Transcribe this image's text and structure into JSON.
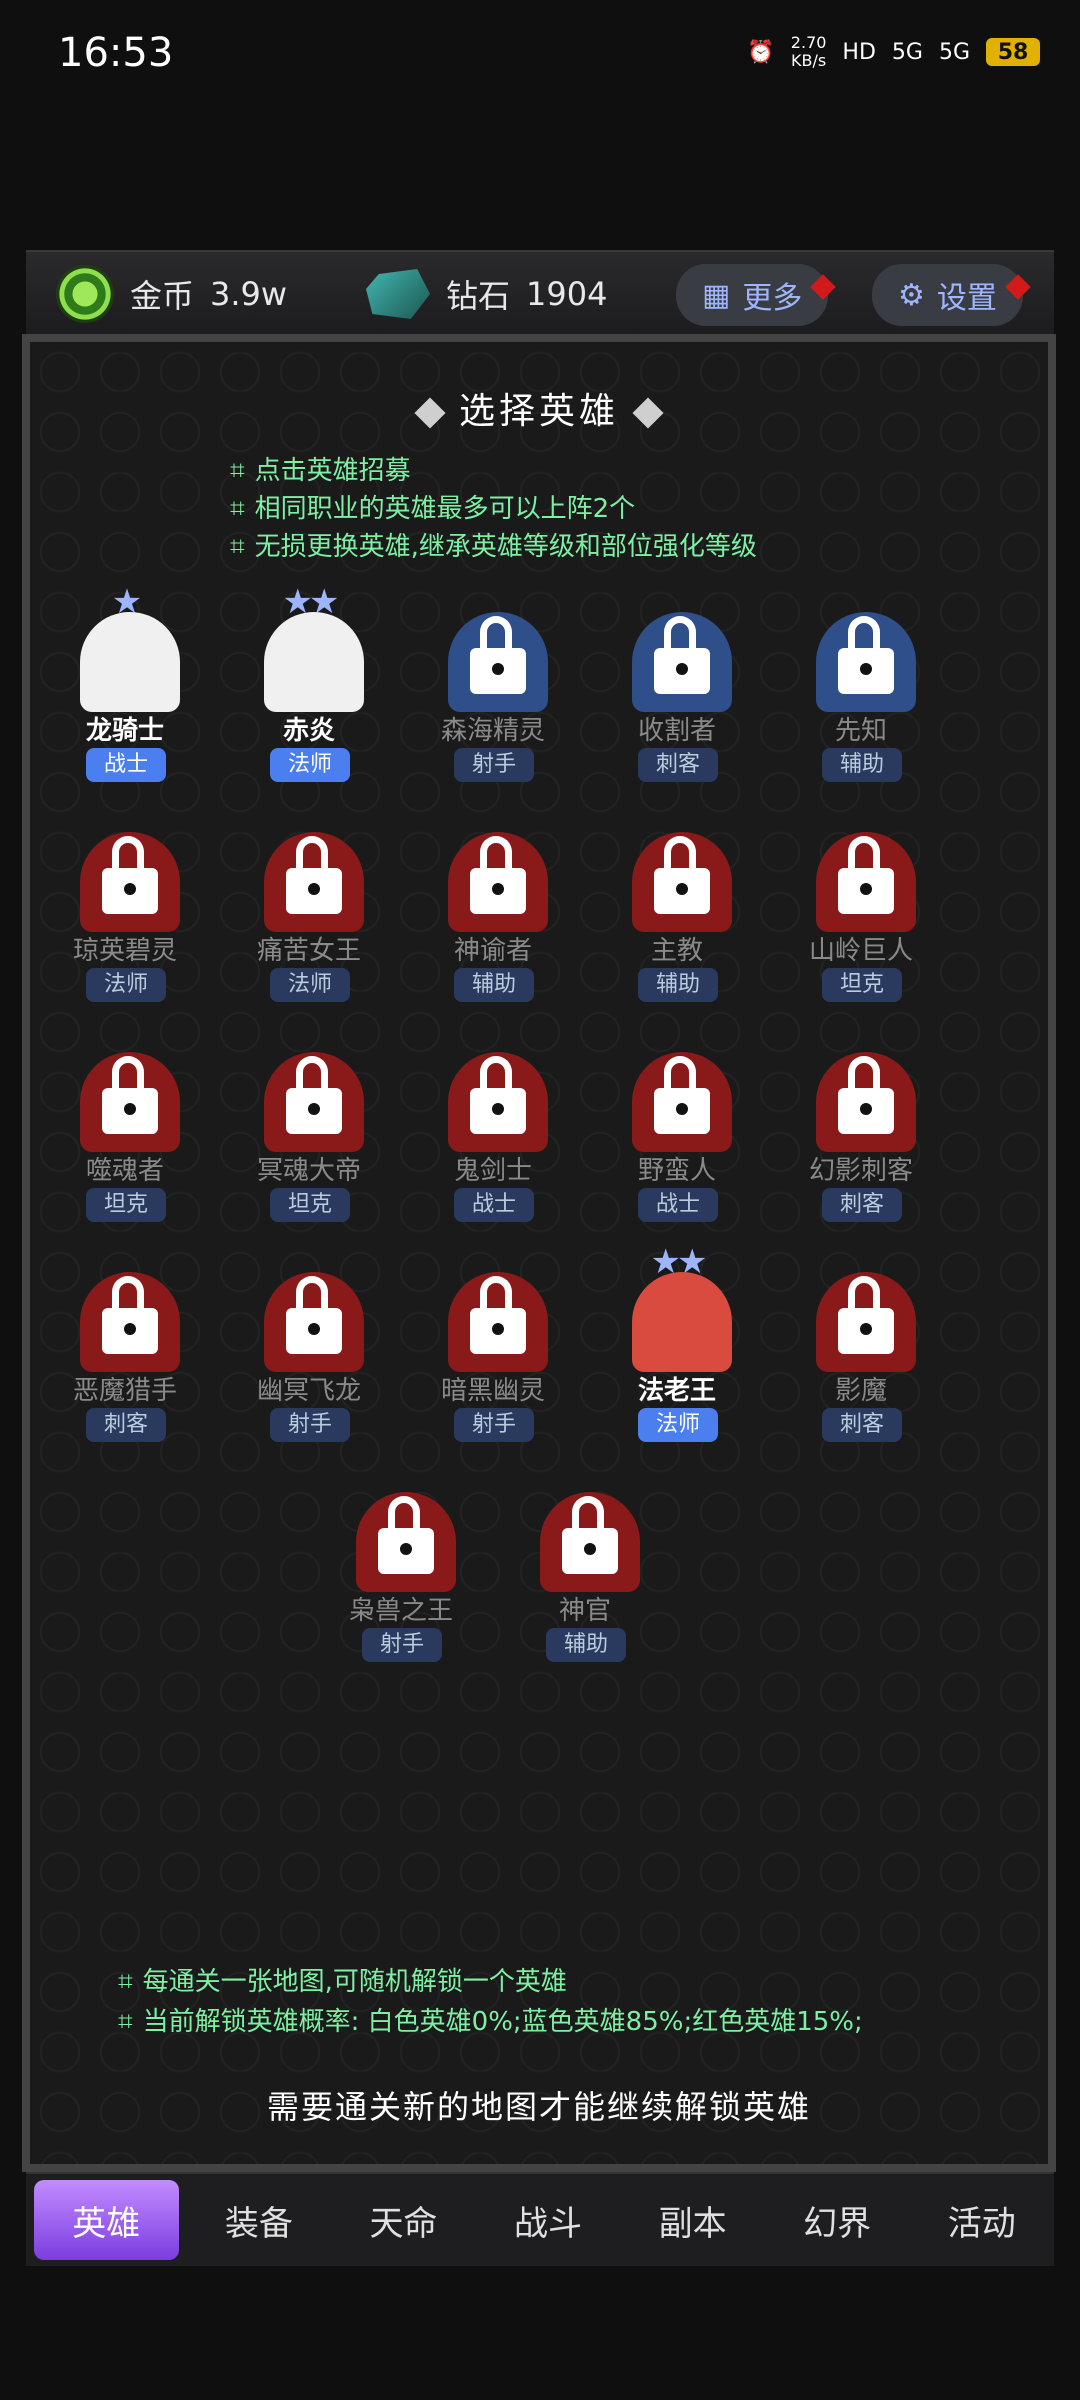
{
  "status": {
    "time": "16:53",
    "net_speed": "2.70",
    "net_unit": "KB/s",
    "hd": "HD",
    "sig1": "5G",
    "sig2": "5G",
    "battery": "58"
  },
  "resources": {
    "coin_label": "金币",
    "coin_value": "3.9w",
    "gem_label": "钻石",
    "gem_value": "1904"
  },
  "buttons": {
    "more": "更多",
    "settings": "设置"
  },
  "panel": {
    "title": "选择英雄",
    "tips": [
      "点击英雄招募",
      "相同职业的英雄最多可以上阵2个",
      "无损更换英雄,继承英雄等级和部位强化等级"
    ],
    "bottom_tips": [
      "每通关一张地图,可随机解锁一个英雄",
      "当前解锁英雄概率: 白色英雄0%;蓝色英雄85%;红色英雄15%;"
    ],
    "unlock_message": "需要通关新的地图才能继续解锁英雄"
  },
  "heroes": [
    {
      "name": "龙骑士",
      "class": "战士",
      "stars": "★",
      "color": "white",
      "unlocked": true
    },
    {
      "name": "赤炎",
      "class": "法师",
      "stars": "★★",
      "color": "white",
      "unlocked": true
    },
    {
      "name": "森海精灵",
      "class": "射手",
      "stars": "",
      "color": "blue",
      "unlocked": false
    },
    {
      "name": "收割者",
      "class": "刺客",
      "stars": "",
      "color": "blue",
      "unlocked": false
    },
    {
      "name": "先知",
      "class": "辅助",
      "stars": "",
      "color": "blue",
      "unlocked": false
    },
    {
      "name": "琼英碧灵",
      "class": "法师",
      "stars": "",
      "color": "red",
      "unlocked": false
    },
    {
      "name": "痛苦女王",
      "class": "法师",
      "stars": "",
      "color": "red",
      "unlocked": false
    },
    {
      "name": "神谕者",
      "class": "辅助",
      "stars": "",
      "color": "red",
      "unlocked": false
    },
    {
      "name": "主教",
      "class": "辅助",
      "stars": "",
      "color": "red",
      "unlocked": false
    },
    {
      "name": "山岭巨人",
      "class": "坦克",
      "stars": "",
      "color": "red",
      "unlocked": false
    },
    {
      "name": "噬魂者",
      "class": "坦克",
      "stars": "",
      "color": "red",
      "unlocked": false
    },
    {
      "name": "冥魂大帝",
      "class": "坦克",
      "stars": "",
      "color": "red",
      "unlocked": false
    },
    {
      "name": "鬼剑士",
      "class": "战士",
      "stars": "",
      "color": "red",
      "unlocked": false
    },
    {
      "name": "野蛮人",
      "class": "战士",
      "stars": "",
      "color": "red",
      "unlocked": false
    },
    {
      "name": "幻影刺客",
      "class": "刺客",
      "stars": "",
      "color": "red",
      "unlocked": false
    },
    {
      "name": "恶魔猎手",
      "class": "刺客",
      "stars": "",
      "color": "red",
      "unlocked": false
    },
    {
      "name": "幽冥飞龙",
      "class": "射手",
      "stars": "",
      "color": "red",
      "unlocked": false
    },
    {
      "name": "暗黑幽灵",
      "class": "射手",
      "stars": "",
      "color": "red",
      "unlocked": false
    },
    {
      "name": "法老王",
      "class": "法师",
      "stars": "★★",
      "color": "redlit",
      "unlocked": true
    },
    {
      "name": "影魔",
      "class": "刺客",
      "stars": "",
      "color": "red",
      "unlocked": false
    },
    {
      "name": "枭兽之王",
      "class": "射手",
      "stars": "",
      "color": "red",
      "unlocked": false
    },
    {
      "name": "神官",
      "class": "辅助",
      "stars": "",
      "color": "red",
      "unlocked": false
    }
  ],
  "nav": [
    "英雄",
    "装备",
    "天命",
    "战斗",
    "副本",
    "幻界",
    "活动"
  ],
  "nav_active": "英雄"
}
